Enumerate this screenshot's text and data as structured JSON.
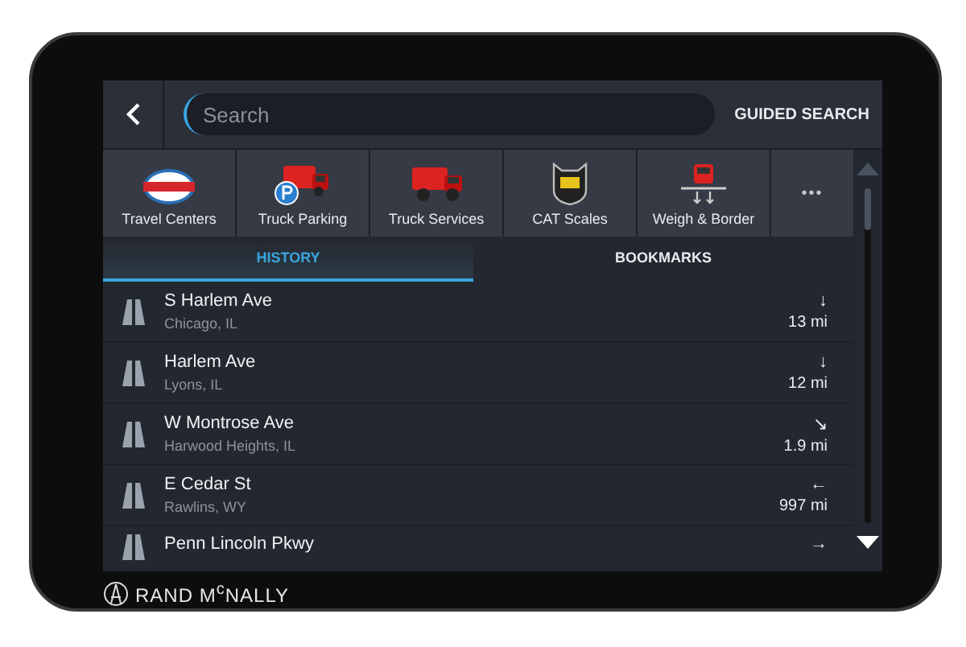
{
  "search": {
    "placeholder": "Search"
  },
  "guided_search": "GUIDED SEARCH",
  "categories": [
    {
      "kind": "travel",
      "label": "Travel Centers"
    },
    {
      "kind": "parking",
      "label": "Truck Parking"
    },
    {
      "kind": "services",
      "label": "Truck Services"
    },
    {
      "kind": "cat",
      "label": "CAT Scales"
    },
    {
      "kind": "weigh",
      "label": "Weigh & Border"
    }
  ],
  "more": "•••",
  "tabs": [
    {
      "label": "HISTORY",
      "selected": true
    },
    {
      "label": "BOOKMARKS",
      "selected": false
    }
  ],
  "history": [
    {
      "name": "S Harlem Ave",
      "place": "Chicago, IL",
      "arrow": "↓",
      "distance": "13 mi"
    },
    {
      "name": "Harlem Ave",
      "place": "Lyons, IL",
      "arrow": "↓",
      "distance": "12 mi"
    },
    {
      "name": "W Montrose Ave",
      "place": "Harwood Heights, IL",
      "arrow": "↘",
      "distance": "1.9 mi"
    },
    {
      "name": "E Cedar St",
      "place": "Rawlins, WY",
      "arrow": "←",
      "distance": "997 mi"
    },
    {
      "name": "Penn Lincoln Pkwy",
      "arrow": "→"
    }
  ],
  "brand": "RAND M$^{c}$NALLY"
}
